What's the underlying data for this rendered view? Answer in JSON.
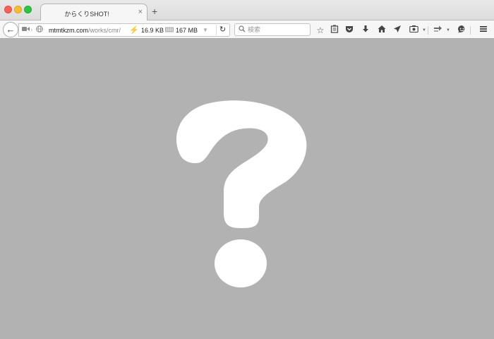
{
  "window": {
    "tab_title": "からくりSHOT!",
    "tab_close_symbol": "×",
    "new_tab_symbol": "+"
  },
  "toolbar": {
    "back_symbol": "←",
    "url_domain": "mtmtkzm.com",
    "url_path": "/works/cmr/",
    "page_size": "16.9 KB",
    "memory": "167 MB",
    "search_placeholder": "検索"
  },
  "colors": {
    "content_bg": "#b2b2b2",
    "question_mark": "#ffffff",
    "close_dot": "#fc5f57",
    "minimize_dot": "#fdbc2e",
    "maximize_dot": "#28c940"
  },
  "icons": [
    "video-icon",
    "globe-icon",
    "bolt-icon",
    "memory-icon",
    "bookmark-star-icon",
    "reading-list-icon",
    "pocket-icon",
    "download-icon",
    "home-icon",
    "send-icon",
    "screenshot-icon",
    "share-icon",
    "smiley-icon",
    "hamburger-menu-icon"
  ]
}
